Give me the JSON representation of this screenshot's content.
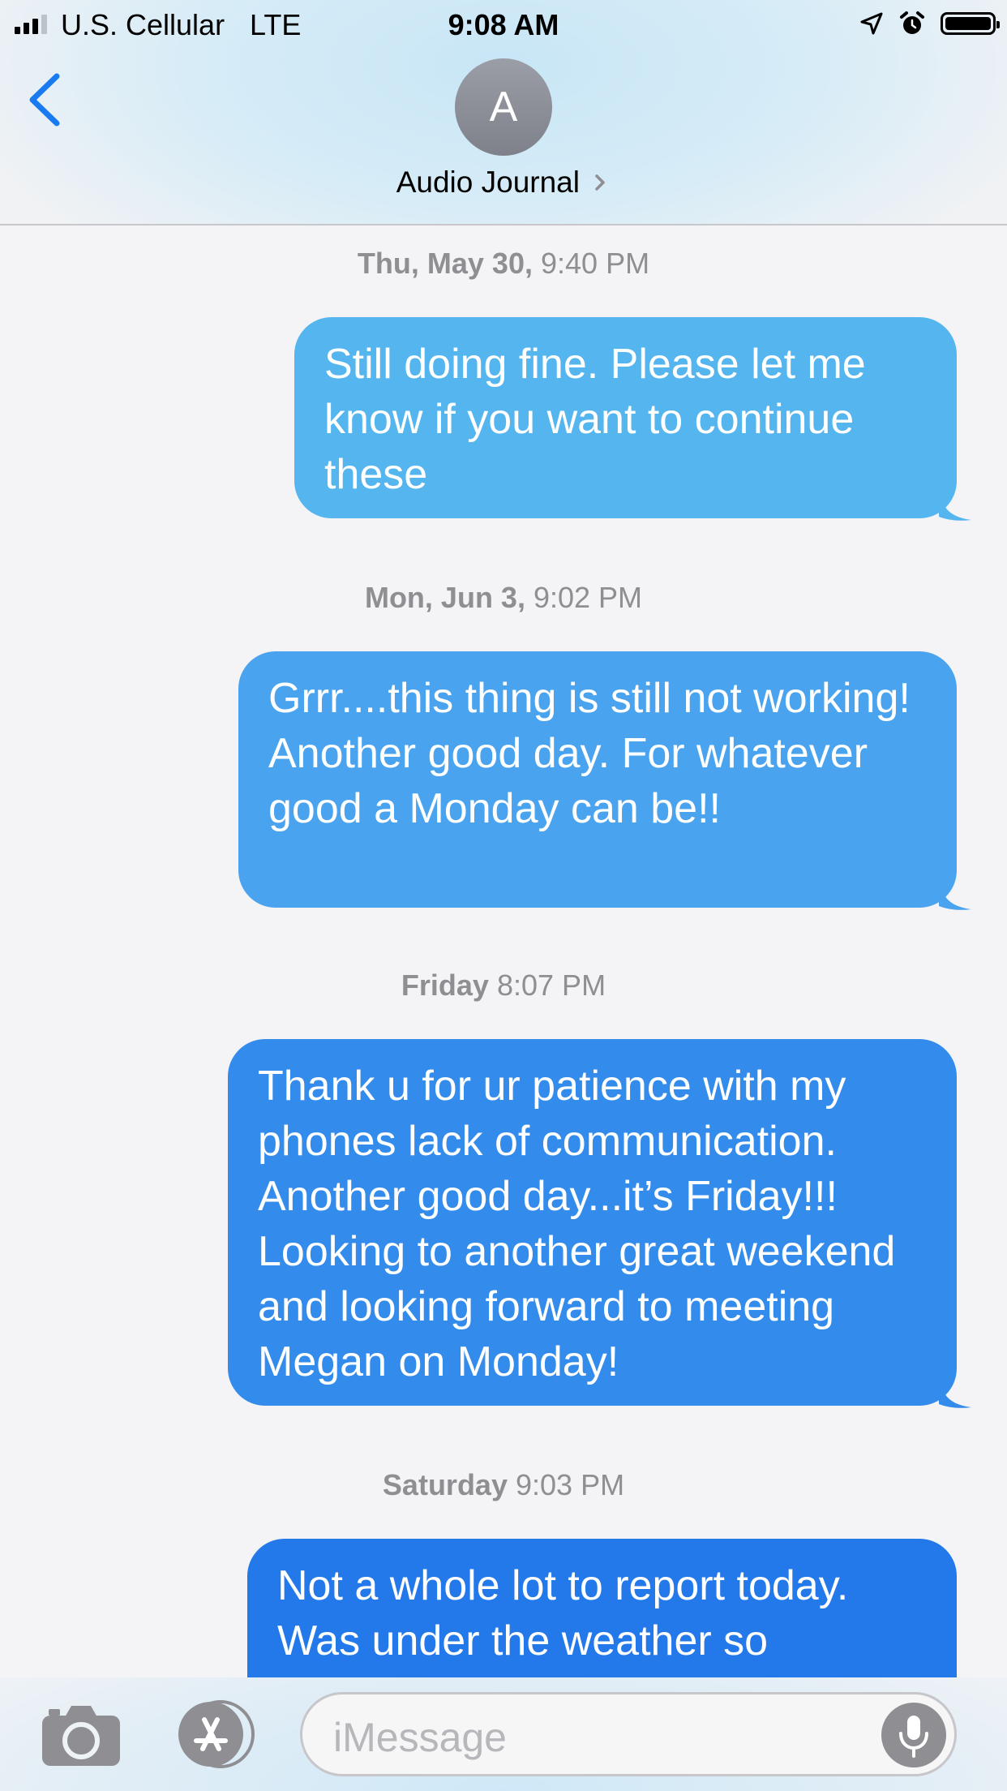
{
  "status_bar": {
    "carrier": "U.S. Cellular",
    "network": "LTE",
    "time": "9:08 AM",
    "signal_bars": 3,
    "icons": [
      "signal-icon",
      "location-arrow-icon",
      "alarm-icon",
      "battery-icon"
    ]
  },
  "header": {
    "back_icon": "chevron-left-icon",
    "avatar_initial": "A",
    "contact_name": "Audio Journal",
    "accent_color": "#1a7bf0"
  },
  "thread": [
    {
      "day": "Thu, May 30,",
      "time": "9:40 PM",
      "message": "Still doing fine. Please let me know if you want to continue these",
      "color": "#55b5ef"
    },
    {
      "day": "Mon, Jun 3,",
      "time": "9:02 PM",
      "message": "Grrr....this thing is still not working! Another good day. For whatever good a Monday can be!!",
      "color": "#4aa3ee"
    },
    {
      "day": "Friday",
      "time": "8:07 PM",
      "message": "Thank u for ur patience with my phones lack of communication. Another good day...it’s Friday!!! Looking to another great weekend and looking forward to meeting Megan on Monday!",
      "color": "#338bec"
    },
    {
      "day": "Saturday",
      "time": "9:03 PM",
      "message": "Not a whole lot to report today. Was under the weather so",
      "color": "#2378ea"
    }
  ],
  "composer": {
    "placeholder": "iMessage",
    "icons": [
      "camera-icon",
      "app-store-icon",
      "microphone-icon"
    ]
  }
}
